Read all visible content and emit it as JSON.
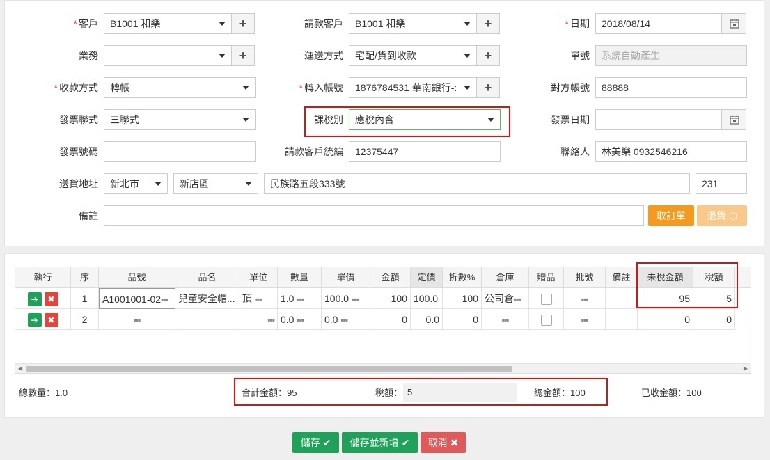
{
  "form": {
    "customer": {
      "label": "客戶",
      "value": "B1001 和樂"
    },
    "billing_customer": {
      "label": "請款客戶",
      "value": "B1001 和樂"
    },
    "date": {
      "label": "日期",
      "value": "2018/08/14"
    },
    "business": {
      "label": "業務",
      "value": ""
    },
    "shipping_method": {
      "label": "運送方式",
      "value": "宅配/貨到收款"
    },
    "order_no": {
      "label": "單號",
      "placeholder": "系統自動產生"
    },
    "payment_method": {
      "label": "收款方式",
      "value": "轉帳"
    },
    "transfer_account": {
      "label": "轉入帳號",
      "value": "1876784531 華南銀行-:"
    },
    "counter_account": {
      "label": "對方帳號",
      "value": "88888"
    },
    "invoice_type": {
      "label": "發票聯式",
      "value": "三聯式"
    },
    "tax_type": {
      "label": "課稅別",
      "value": "應稅內含"
    },
    "invoice_date": {
      "label": "發票日期",
      "value": ""
    },
    "invoice_no": {
      "label": "發票號碼",
      "value": ""
    },
    "billing_tax_id": {
      "label": "請款客戶統編",
      "value": "12375447"
    },
    "contact": {
      "label": "聯絡人",
      "value": "林美樂 0932546216"
    },
    "address": {
      "label": "送貨地址",
      "city": "新北市",
      "district": "新店區",
      "street": "民族路五段333號",
      "zip": "231"
    },
    "remark": {
      "label": "備註",
      "value": ""
    },
    "cancel_order_btn": "取訂單",
    "return_btn": "退貨"
  },
  "grid": {
    "headers": [
      "執行",
      "序",
      "品號",
      "品名",
      "單位",
      "數量",
      "單價",
      "金額",
      "定價",
      "折數%",
      "倉庫",
      "贈品",
      "批號",
      "備註",
      "未稅金額",
      "稅額"
    ],
    "rows": [
      {
        "seq": "1",
        "item_no": "A1001001-02",
        "item_name": "兒童安全帽...",
        "unit": "頂",
        "qty": "1.0",
        "price": "100.0",
        "amount": "100",
        "list_price": "100.0",
        "discount": "100",
        "warehouse": "公司倉",
        "pretax": "95",
        "tax": "5"
      },
      {
        "seq": "2",
        "item_no": "",
        "item_name": "",
        "unit": "",
        "qty": "0.0",
        "price": "0.0",
        "amount": "0",
        "list_price": "0.0",
        "discount": "0",
        "warehouse": "",
        "pretax": "0",
        "tax": "0"
      }
    ]
  },
  "summary": {
    "total_qty": "總數量：1.0",
    "subtotal": "合計金額：95",
    "tax_label": "稅額：",
    "tax_value": "5",
    "grand_total": "總金額：100",
    "received": "已收金額：100"
  },
  "footer": {
    "save": "儲存",
    "save_new": "儲存並新增",
    "cancel": "取消"
  },
  "icons": {
    "add": "plus-icon",
    "calendar": "calendar-icon",
    "go": "arrow-right-icon",
    "delete": "x-icon"
  },
  "colors": {
    "accent_orange": "#f39a1f",
    "green": "#1fa15a",
    "red": "#e05a5a",
    "highlight": "#e01010"
  }
}
